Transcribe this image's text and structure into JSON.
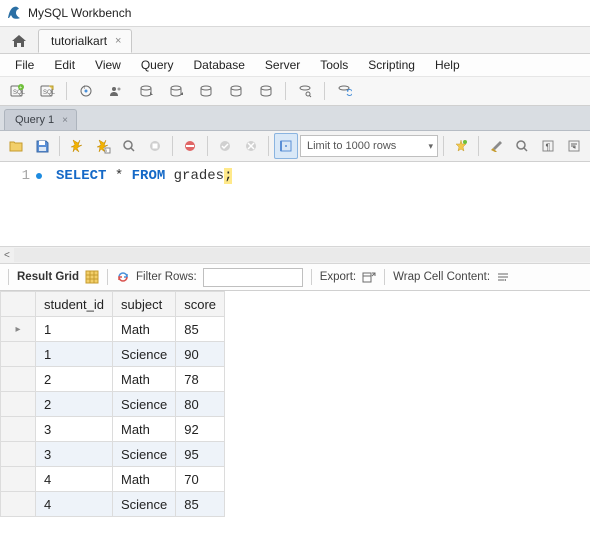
{
  "app": {
    "title": "MySQL Workbench"
  },
  "connection_tab": {
    "label": "tutorialkart"
  },
  "menu": {
    "items": [
      {
        "label": "File"
      },
      {
        "label": "Edit"
      },
      {
        "label": "View"
      },
      {
        "label": "Query"
      },
      {
        "label": "Database"
      },
      {
        "label": "Server"
      },
      {
        "label": "Tools"
      },
      {
        "label": "Scripting"
      },
      {
        "label": "Help"
      }
    ]
  },
  "query_tab": {
    "label": "Query 1"
  },
  "editor_toolbar": {
    "limit_label": "Limit to 1000 rows"
  },
  "sql": {
    "line_number": "1",
    "kw_select": "SELECT",
    "star": "*",
    "kw_from": "FROM",
    "table": "grades",
    "semicolon": ";"
  },
  "result_bar": {
    "result_grid_label": "Result Grid",
    "filter_rows_label": "Filter Rows:",
    "filter_value": "",
    "export_label": "Export:",
    "wrap_label": "Wrap Cell Content:"
  },
  "chart_data": {
    "type": "table",
    "columns": [
      "student_id",
      "subject",
      "score"
    ],
    "rows": [
      [
        "1",
        "Math",
        "85"
      ],
      [
        "1",
        "Science",
        "90"
      ],
      [
        "2",
        "Math",
        "78"
      ],
      [
        "2",
        "Science",
        "80"
      ],
      [
        "3",
        "Math",
        "92"
      ],
      [
        "3",
        "Science",
        "95"
      ],
      [
        "4",
        "Math",
        "70"
      ],
      [
        "4",
        "Science",
        "85"
      ]
    ]
  }
}
